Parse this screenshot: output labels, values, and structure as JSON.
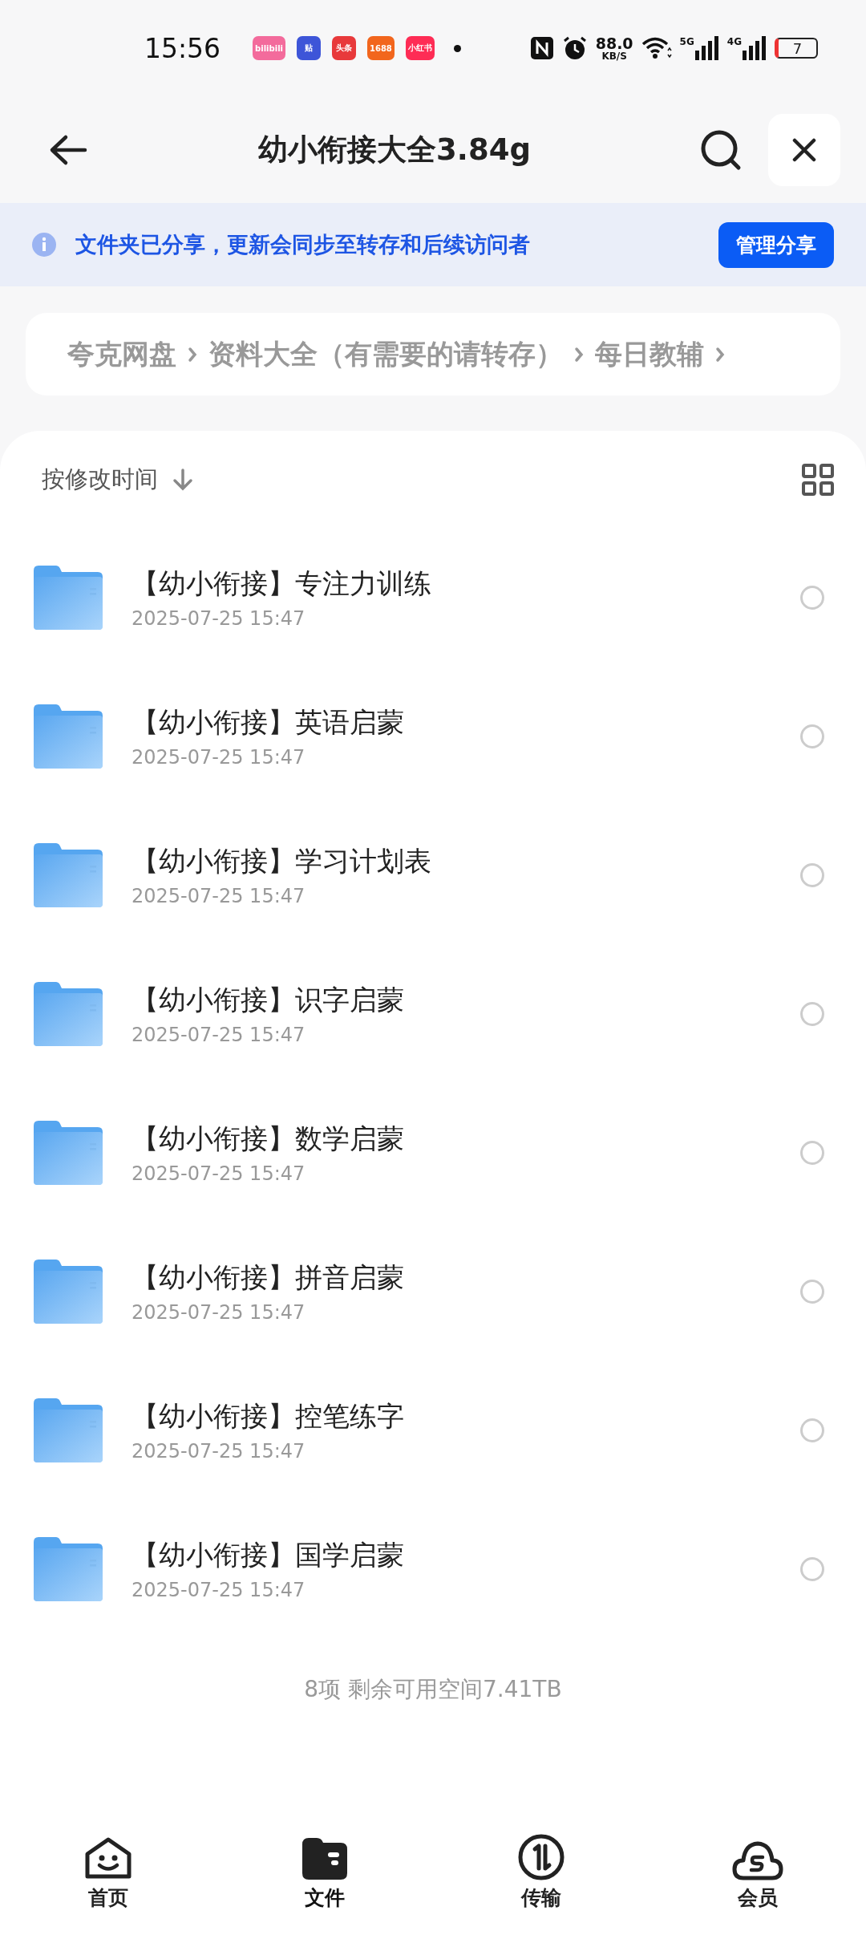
{
  "status_bar": {
    "time": "15:56",
    "apps": [
      {
        "label": "bilibili",
        "color": "#f36b9c"
      },
      {
        "label": "贴",
        "color": "#3d55d8"
      },
      {
        "label": "头条",
        "color": "#e8393b"
      },
      {
        "label": "1688",
        "color": "#f2661d"
      },
      {
        "label": "小红书",
        "color": "#fe2c55"
      }
    ],
    "speed": "88.0",
    "speed_unit": "KB/S",
    "net_5g": "5G",
    "net_4g": "4G",
    "battery": "7"
  },
  "header": {
    "title": "幼小衔接大全3.84g"
  },
  "banner": {
    "text": "文件夹已分享，更新会同步至转存和后续访问者",
    "button": "管理分享"
  },
  "breadcrumb": [
    "夸克网盘",
    "资料大全（有需要的请转存）",
    "每日教辅"
  ],
  "sort": {
    "label": "按修改时间"
  },
  "files": [
    {
      "name": "【幼小衔接】专注力训练",
      "date": "2025-07-25 15:47",
      "selected": false
    },
    {
      "name": "【幼小衔接】英语启蒙",
      "date": "2025-07-25 15:47",
      "selected": false
    },
    {
      "name": "【幼小衔接】学习计划表",
      "date": "2025-07-25 15:47",
      "selected": false
    },
    {
      "name": "【幼小衔接】识字启蒙",
      "date": "2025-07-25 15:47",
      "selected": false
    },
    {
      "name": "【幼小衔接】数学启蒙",
      "date": "2025-07-25 15:47",
      "selected": false
    },
    {
      "name": "【幼小衔接】拼音启蒙",
      "date": "2025-07-25 15:47",
      "selected": false
    },
    {
      "name": "【幼小衔接】控笔练字",
      "date": "2025-07-25 15:47",
      "selected": false
    },
    {
      "name": "【幼小衔接】国学启蒙",
      "date": "2025-07-25 15:47",
      "selected": false
    }
  ],
  "footer": "8项 剩余可用空间7.41TB",
  "nav": [
    {
      "kind": "home",
      "label": "首页",
      "selected": false
    },
    {
      "kind": "files",
      "label": "文件",
      "selected": true
    },
    {
      "kind": "transfer",
      "label": "传输",
      "selected": false
    },
    {
      "kind": "member",
      "label": "会员",
      "selected": false
    }
  ]
}
